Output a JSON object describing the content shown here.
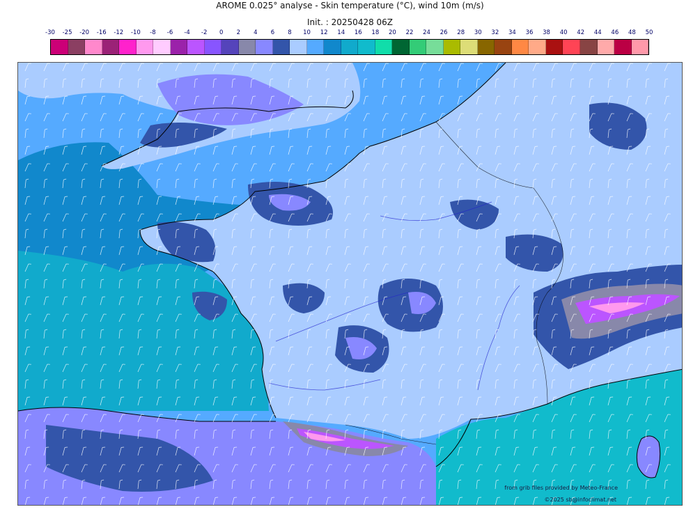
{
  "header": {
    "title": "AROME 0.025° analyse - Skin temperature (°C), wind 10m (m/s)",
    "subtitle": "Init. : 20250428 06Z"
  },
  "colorbar": {
    "ticks": [
      "-30",
      "-25",
      "-20",
      "-16",
      "-12",
      "-10",
      "-8",
      "-6",
      "-4",
      "-2",
      "0",
      "2",
      "4",
      "6",
      "8",
      "10",
      "12",
      "14",
      "16",
      "18",
      "20",
      "22",
      "24",
      "26",
      "28",
      "30",
      "32",
      "34",
      "36",
      "38",
      "40",
      "42",
      "44",
      "46",
      "48",
      "50"
    ],
    "colors": [
      "#cc0077",
      "#8b3f62",
      "#ff88cc",
      "#9b2277",
      "#ff22cc",
      "#ff99ee",
      "#ffccff",
      "#9b22aa",
      "#bb55ff",
      "#8855ff",
      "#5544bb",
      "#8888aa",
      "#8888ff",
      "#3355aa",
      "#aaccff",
      "#55aaff",
      "#1188cc",
      "#11aacc",
      "#11bbcc",
      "#11ddaa",
      "#006633",
      "#33cc77",
      "#77dd99",
      "#aabb00",
      "#dddd77",
      "#886600",
      "#994411",
      "#ff8844",
      "#ffaa88",
      "#aa1111",
      "#ff4455",
      "#884444",
      "#ffaaaa",
      "#bb0044",
      "#ff99aa"
    ]
  },
  "map": {
    "palette": {
      "sea_cold": "#1188cc",
      "sea_mid": "#55aaff",
      "sea_warm": "#11aacc",
      "sea_south": "#11bbcc",
      "land_light": "#aaccff",
      "land_mid": "#3355aa",
      "land_purple": "#8888ff",
      "land_grey": "#8888aa",
      "alps_violet": "#bb55ff",
      "alps_pink": "#ff99ee",
      "coast": "#000000",
      "wind": "#ffffff"
    }
  },
  "credits": {
    "source": "from grib files provided by Meteo-France",
    "copyright": "©2025 sb@infoclimat.net"
  }
}
